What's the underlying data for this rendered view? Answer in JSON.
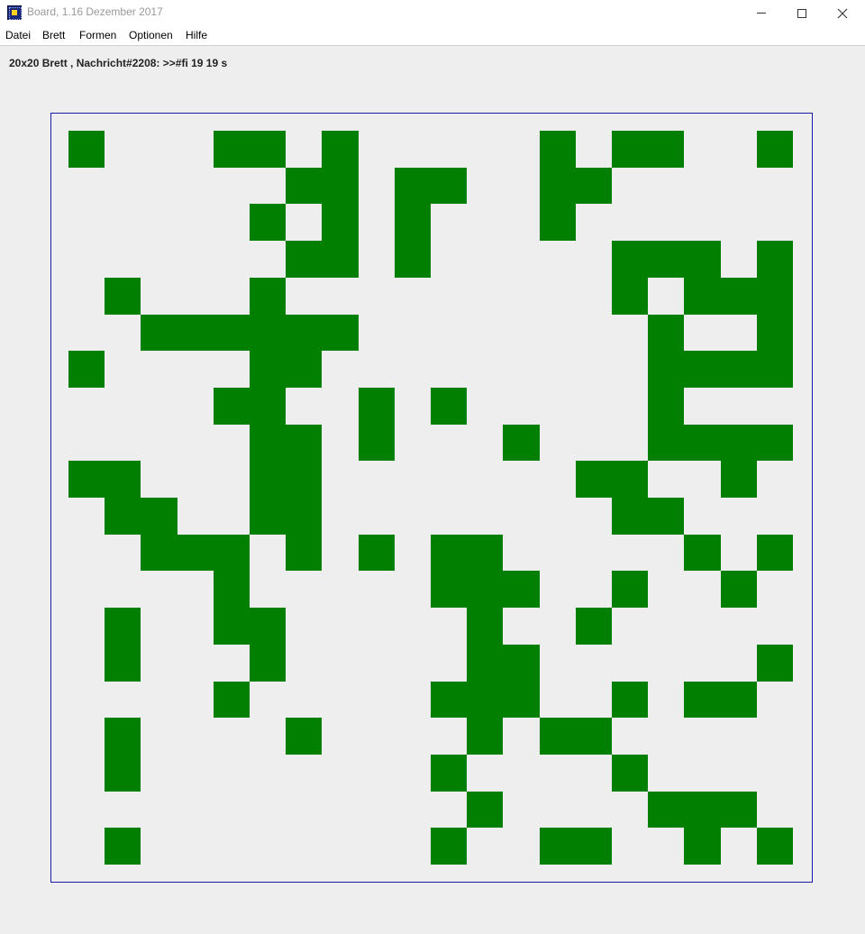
{
  "window": {
    "title": "Board, 1.16 Dezember 2017",
    "app_icon": "board-app-icon",
    "controls": [
      "minimize-icon",
      "maximize-icon",
      "close-icon"
    ]
  },
  "menu": [
    {
      "label": "Datei"
    },
    {
      "label": "Brett"
    },
    {
      "label": "Formen"
    },
    {
      "label": "Optionen"
    },
    {
      "label": "Hilfe"
    }
  ],
  "status": {
    "text": "20x20 Brett , Nachricht#2208: >>#fi 19 19 s"
  },
  "board": {
    "columns": 20,
    "rows": 20,
    "filled_color": "#007f00",
    "empty_color": "#eeeeee",
    "border_color": "#1a1aa8",
    "grid": [
      "10001101000001011001",
      "00000011011001100000",
      "00000101010001000000",
      "00000011010000011101",
      "01000100000000010111",
      "00111111000000001001",
      "10000110000000001111",
      "00001100101000001000",
      "00000110100010001111",
      "11000110000000110010",
      "01100110000000011000",
      "00111010101100000101",
      "00001000001110010010",
      "01001100000100100000",
      "01000100000110000001",
      "00001000001110010110",
      "01000010000101100000",
      "01000000001000010000",
      "00000000000100001110",
      "01000000001001100101"
    ]
  }
}
